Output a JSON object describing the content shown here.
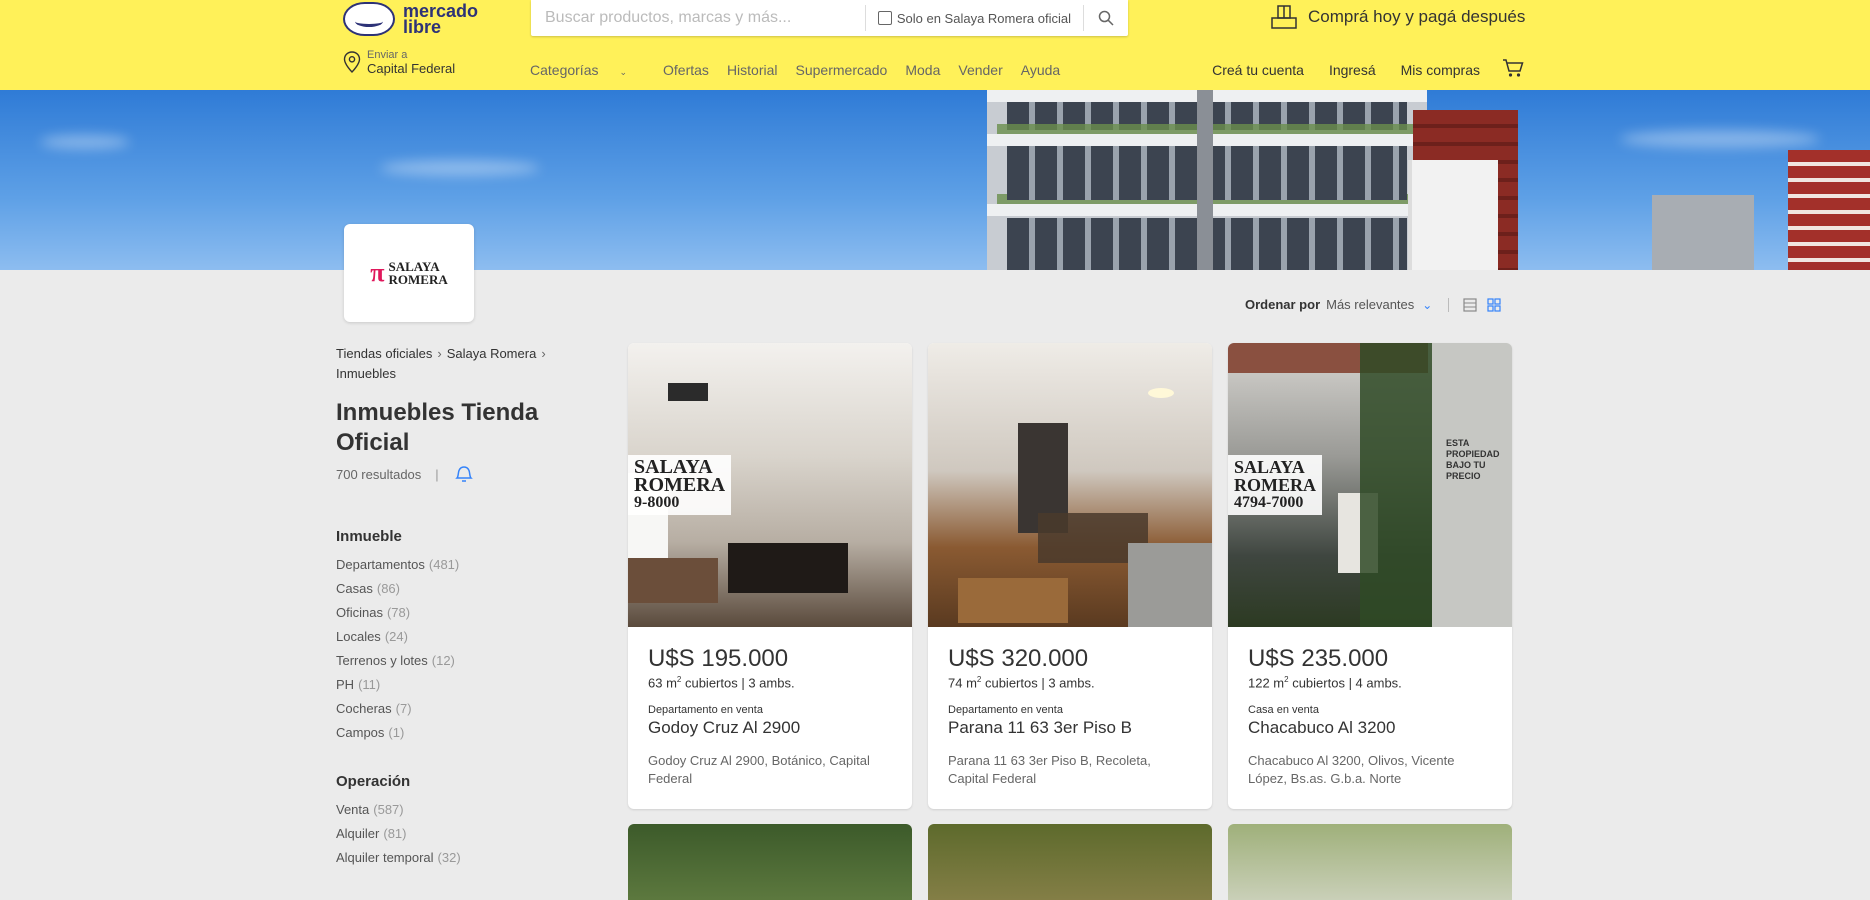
{
  "colors": {
    "header_bg": "#fff159",
    "accent_blue": "#3483fa",
    "brand_pink": "#e0185c"
  },
  "header": {
    "logo_text_1": "mercado",
    "logo_text_2": "libre",
    "search_placeholder": "Buscar productos, marcas y más...",
    "search_scope_label": "Solo en Salaya Romera oficial",
    "promo_text": "Comprá hoy y pagá después",
    "location_small": "Enviar a",
    "location_big": "Capital Federal",
    "nav": [
      "Categorías",
      "Ofertas",
      "Historial",
      "Supermercado",
      "Moda",
      "Vender",
      "Ayuda"
    ],
    "user_nav": [
      "Creá tu cuenta",
      "Ingresá",
      "Mis compras"
    ]
  },
  "store": {
    "logo_mark": "π",
    "logo_line1": "SALAYA",
    "logo_line2": "ROMERA"
  },
  "sort": {
    "label": "Ordenar por",
    "value": "Más relevantes"
  },
  "breadcrumb": [
    "Tiendas oficiales",
    "Salaya Romera",
    "Inmuebles"
  ],
  "page": {
    "title": "Inmuebles Tienda Oficial",
    "results": "700 resultados"
  },
  "filters": [
    {
      "title": "Inmueble",
      "items": [
        {
          "label": "Departamentos",
          "count": "(481)"
        },
        {
          "label": "Casas",
          "count": "(86)"
        },
        {
          "label": "Oficinas",
          "count": "(78)"
        },
        {
          "label": "Locales",
          "count": "(24)"
        },
        {
          "label": "Terrenos y lotes",
          "count": "(12)"
        },
        {
          "label": "PH",
          "count": "(11)"
        },
        {
          "label": "Cocheras",
          "count": "(7)"
        },
        {
          "label": "Campos",
          "count": "(1)"
        }
      ]
    },
    {
      "title": "Operación",
      "items": [
        {
          "label": "Venta",
          "count": "(587)"
        },
        {
          "label": "Alquiler",
          "count": "(81)"
        },
        {
          "label": "Alquiler temporal",
          "count": "(32)"
        }
      ]
    }
  ],
  "listings": [
    {
      "price": "U$S 195.000",
      "area": "63 m",
      "attrs_rest": " cubiertos | 3 ambs.",
      "kind": "Departamento en venta",
      "title": "Godoy Cruz Al 2900",
      "address": "Godoy Cruz Al 2900, Botánico, Capital Federal",
      "watermark_1": "SALAYA",
      "watermark_2": "ROMERA",
      "watermark_3": "9-8000"
    },
    {
      "price": "U$S 320.000",
      "area": "74 m",
      "attrs_rest": " cubiertos | 3 ambs.",
      "kind": "Departamento en venta",
      "title": "Parana 11 63 3er Piso B",
      "address": "Parana 11 63 3er Piso B, Recoleta, Capital Federal"
    },
    {
      "price": "U$S 235.000",
      "area": "122 m",
      "attrs_rest": " cubiertos | 4 ambs.",
      "kind": "Casa en venta",
      "title": "Chacabuco Al 3200",
      "address": "Chacabuco Al 3200, Olivos, Vicente López, Bs.as. G.b.a. Norte",
      "watermark_1": "SALAYA",
      "watermark_2": "ROMERA",
      "watermark_3": "4794-7000",
      "side_sign": "ESTA PROPIEDAD BAJO TU PRECIO"
    }
  ],
  "icons": [
    "location-pin-icon",
    "search-icon",
    "promo-icon",
    "cart-icon",
    "bell-icon",
    "list-view-icon",
    "grid-view-icon",
    "chevron-down-icon",
    "chevron-right-icon"
  ]
}
